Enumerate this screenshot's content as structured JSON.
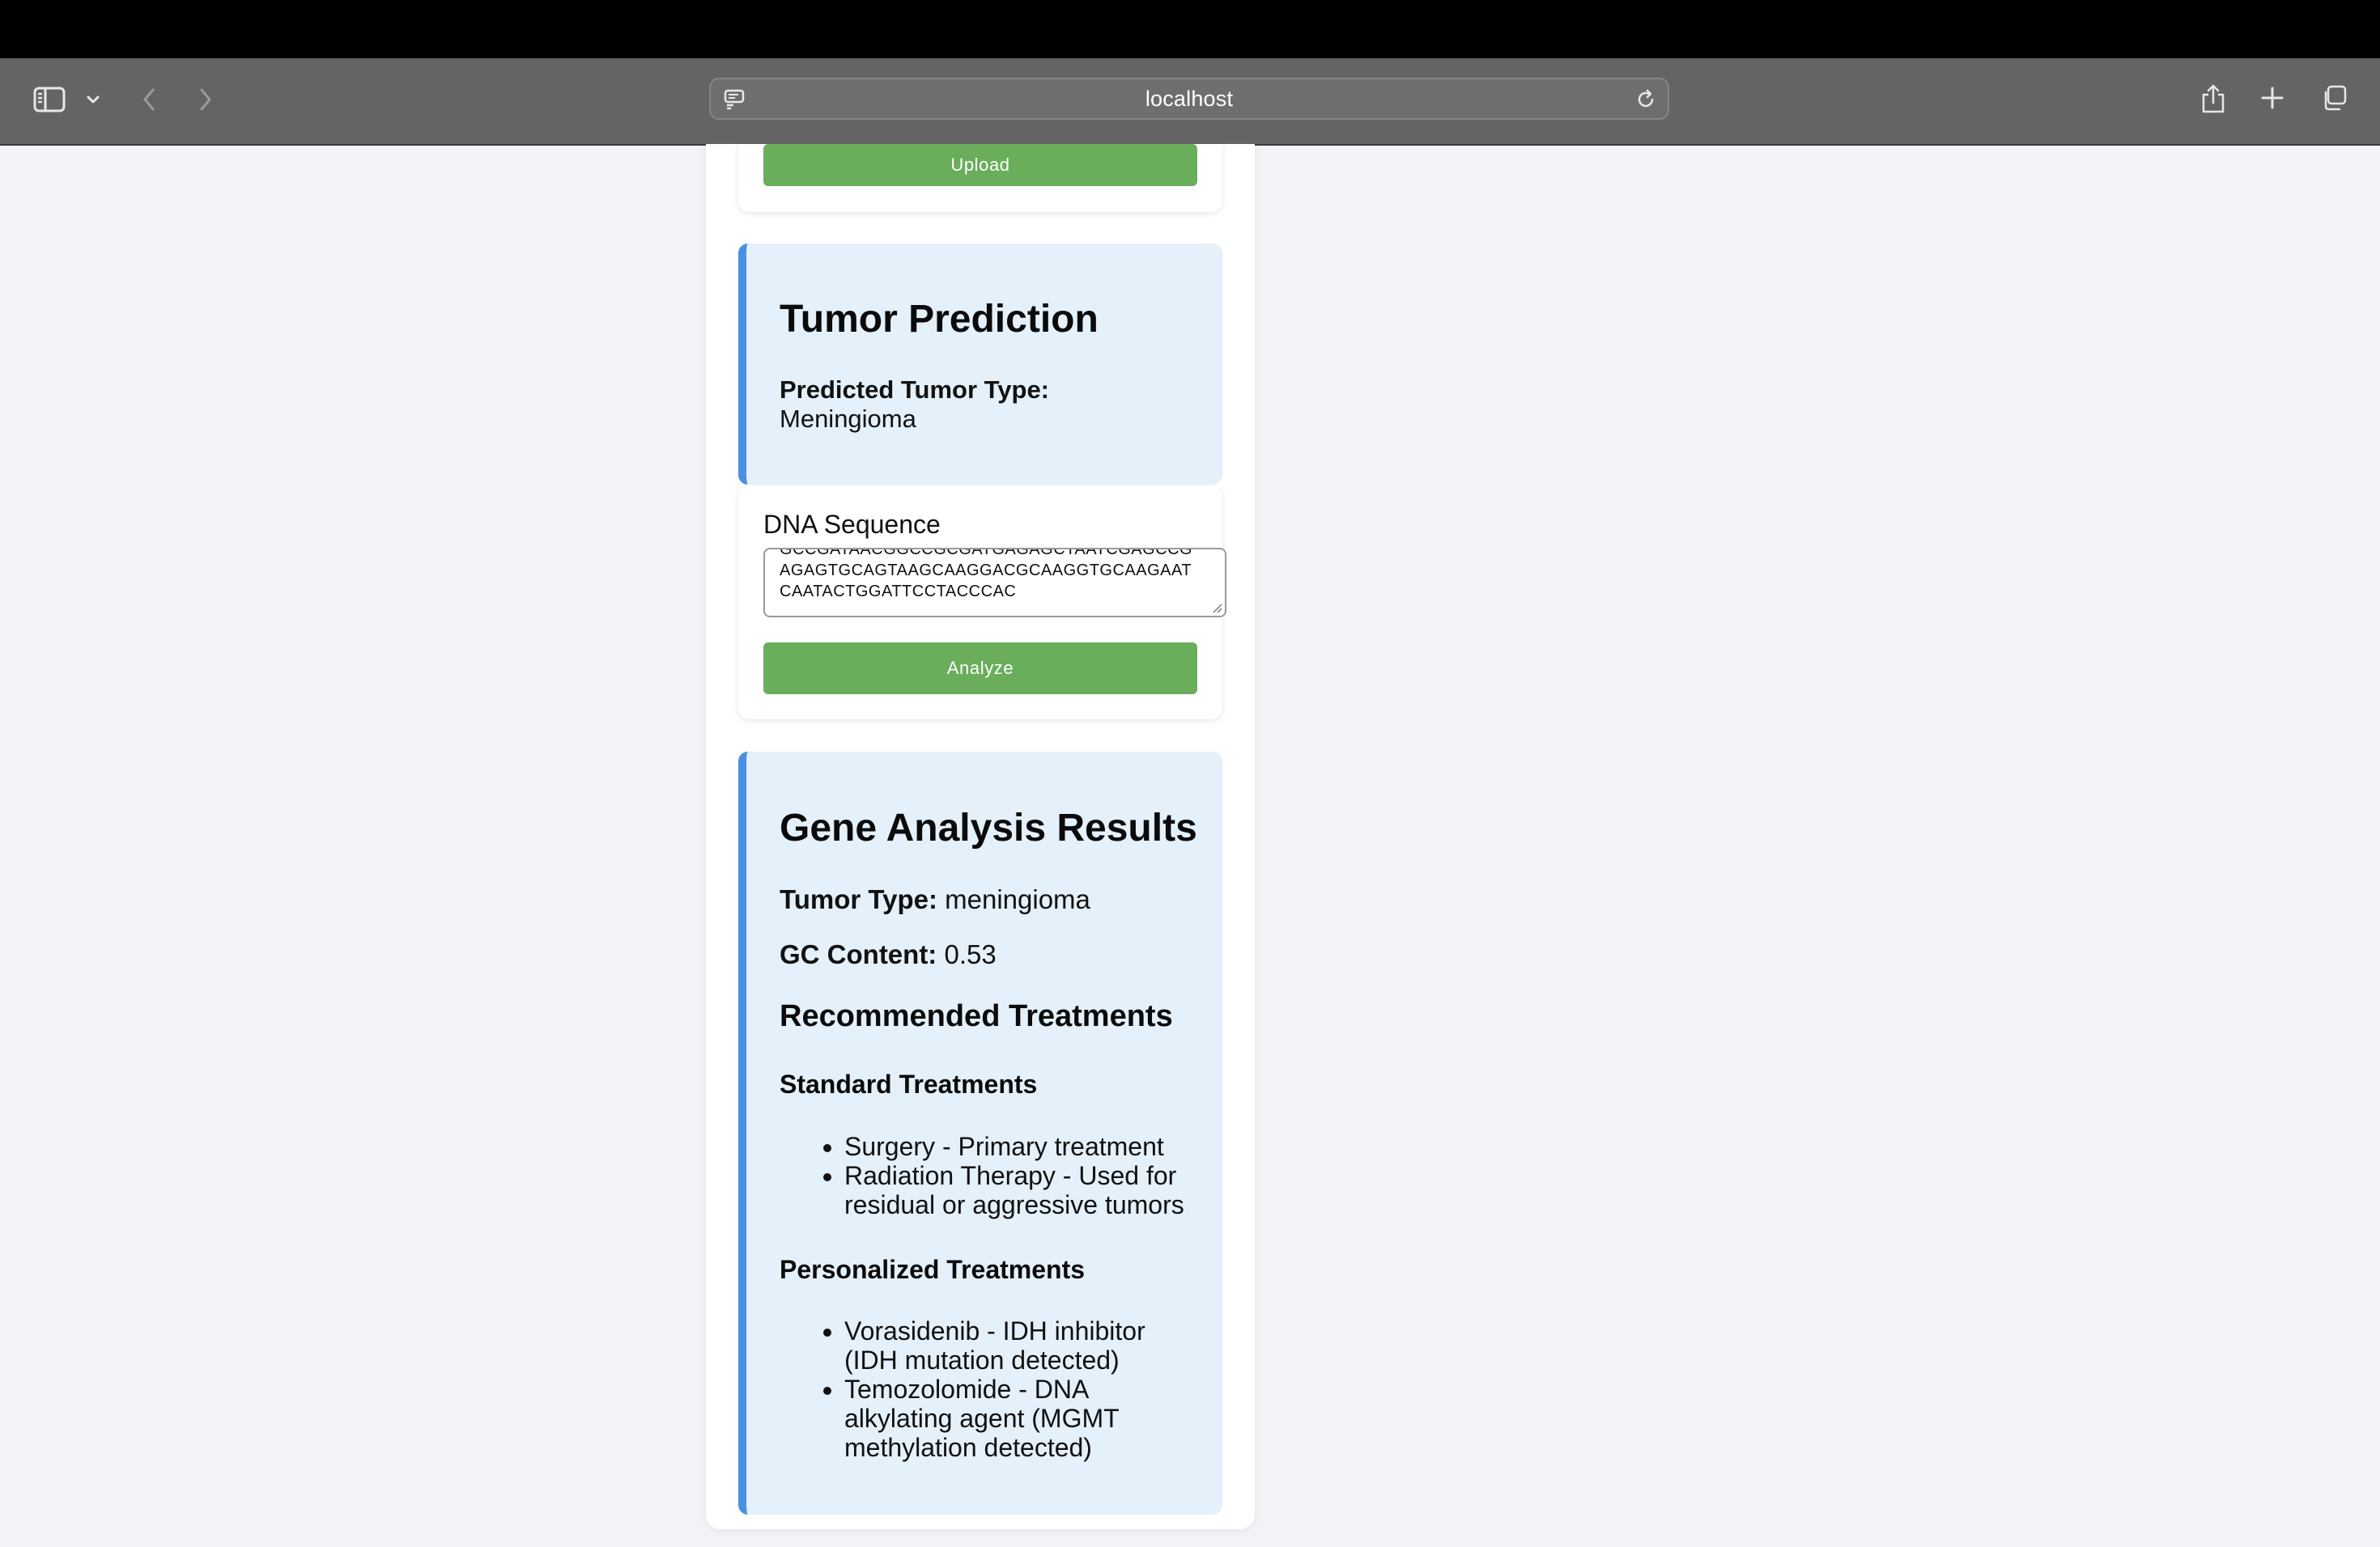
{
  "browser": {
    "url": "localhost"
  },
  "upload": {
    "button_label": "Upload"
  },
  "prediction": {
    "title": "Tumor Prediction",
    "label": "Predicted Tumor Type:",
    "value": "Meningioma"
  },
  "dna": {
    "label": "DNA Sequence",
    "lines": [
      "GCCGATAACGGCCGCGATGAGAGCTAATCGAGCCG",
      "AGAGTGCAGTAAGCAAGGACGCAAGGTGCAAGAAT",
      "CAATACTGGATTCCTACCCAC"
    ],
    "button_label": "Analyze"
  },
  "results": {
    "title": "Gene Analysis Results",
    "tumor_type_label": "Tumor Type:",
    "tumor_type_value": "meningioma",
    "gc_label": "GC Content:",
    "gc_value": "0.53",
    "treatments_title": "Recommended Treatments",
    "standard_title": "Standard Treatments",
    "standard_items": [
      "Surgery - Primary treatment",
      "Radiation Therapy - Used for residual or aggressive tumors"
    ],
    "personalized_title": "Personalized Treatments",
    "personalized_items": [
      "Vorasidenib - IDH inhibitor (IDH mutation detected)",
      "Temozolomide - DNA alkylating agent (MGMT methylation detected)"
    ]
  },
  "colors": {
    "button_green": "#6aad5b",
    "accent_blue": "#4a90e2",
    "result_bg": "#e4f0fa",
    "toolbar_gray": "#646464"
  }
}
